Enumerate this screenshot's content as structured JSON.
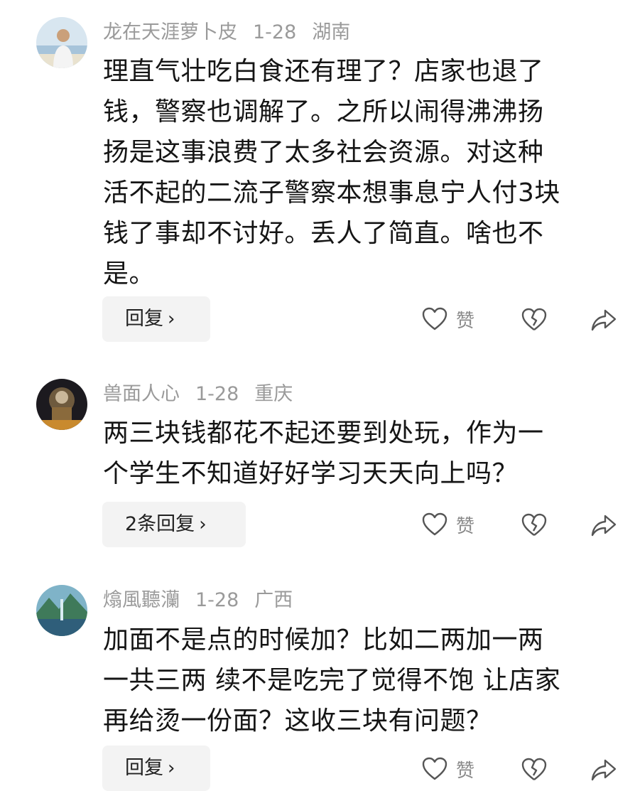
{
  "comments": [
    {
      "author": "龙在天涯萝卜皮",
      "date": "1-28",
      "location": "湖南",
      "lines": [
        "理直气壮吃白食还有理了？店家也退了",
        "钱，警察也调解了。之所以闹得沸沸扬",
        "扬是这事浪费了太多社会资源。对这种",
        "活不起的二流子警察本想事息宁人付3块",
        "钱了事却不讨好。丢人了简直。啥也不",
        "是。"
      ],
      "reply_label": "回复",
      "like_label": "赞"
    },
    {
      "author": "兽面人心",
      "date": "1-28",
      "location": "重庆",
      "lines": [
        "两三块钱都花不起还要到处玩，作为一",
        "个学生不知道好好学习天天向上吗？"
      ],
      "reply_label": "2条回复",
      "like_label": "赞"
    },
    {
      "author": "熻風聽灡",
      "date": "1-28",
      "location": "广西",
      "lines": [
        "加面不是点的时候加？比如二两加一两",
        "一共三两 续不是吃完了觉得不饱 让店家",
        "再给烫一份面？这收三块有问题？"
      ],
      "reply_label": "回复",
      "like_label": "赞"
    }
  ],
  "icons": {
    "like": "heart-outline-icon",
    "dislike": "broken-heart-icon",
    "share": "share-arrow-icon",
    "chevron": "chevron-right-icon"
  },
  "colors": {
    "meta_text": "#9a9a9a",
    "body_text": "#151515",
    "button_bg": "#f3f3f3",
    "icon_stroke": "#555555"
  }
}
